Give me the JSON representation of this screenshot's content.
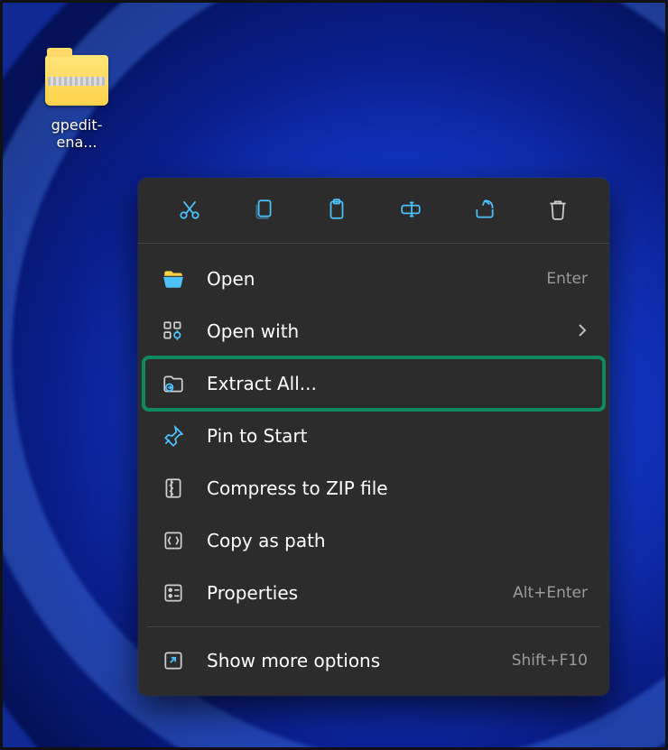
{
  "desktop": {
    "icon_label": "gpedit-ena..."
  },
  "context_menu": {
    "toolbar": [
      {
        "name": "cut",
        "icon": "cut-icon"
      },
      {
        "name": "copy",
        "icon": "copy-icon"
      },
      {
        "name": "paste",
        "icon": "paste-icon"
      },
      {
        "name": "rename",
        "icon": "rename-icon"
      },
      {
        "name": "share",
        "icon": "share-icon"
      },
      {
        "name": "delete",
        "icon": "delete-icon"
      }
    ],
    "items": [
      {
        "icon": "folder-open-icon",
        "label": "Open",
        "shortcut": "Enter",
        "submenu": false
      },
      {
        "icon": "open-with-icon",
        "label": "Open with",
        "shortcut": "",
        "submenu": true
      },
      {
        "icon": "extract-icon",
        "label": "Extract All...",
        "shortcut": "",
        "submenu": false,
        "highlighted": true
      },
      {
        "icon": "pin-icon",
        "label": "Pin to Start",
        "shortcut": "",
        "submenu": false
      },
      {
        "icon": "compress-icon",
        "label": "Compress to ZIP file",
        "shortcut": "",
        "submenu": false
      },
      {
        "icon": "copy-path-icon",
        "label": "Copy as path",
        "shortcut": "",
        "submenu": false
      },
      {
        "icon": "properties-icon",
        "label": "Properties",
        "shortcut": "Alt+Enter",
        "submenu": false
      },
      {
        "icon": "sep"
      },
      {
        "icon": "show-more-icon",
        "label": "Show more options",
        "shortcut": "Shift+F10",
        "submenu": false
      }
    ]
  },
  "colors": {
    "accent": "#4cc2ff",
    "highlight_box": "#0f8a5f"
  }
}
